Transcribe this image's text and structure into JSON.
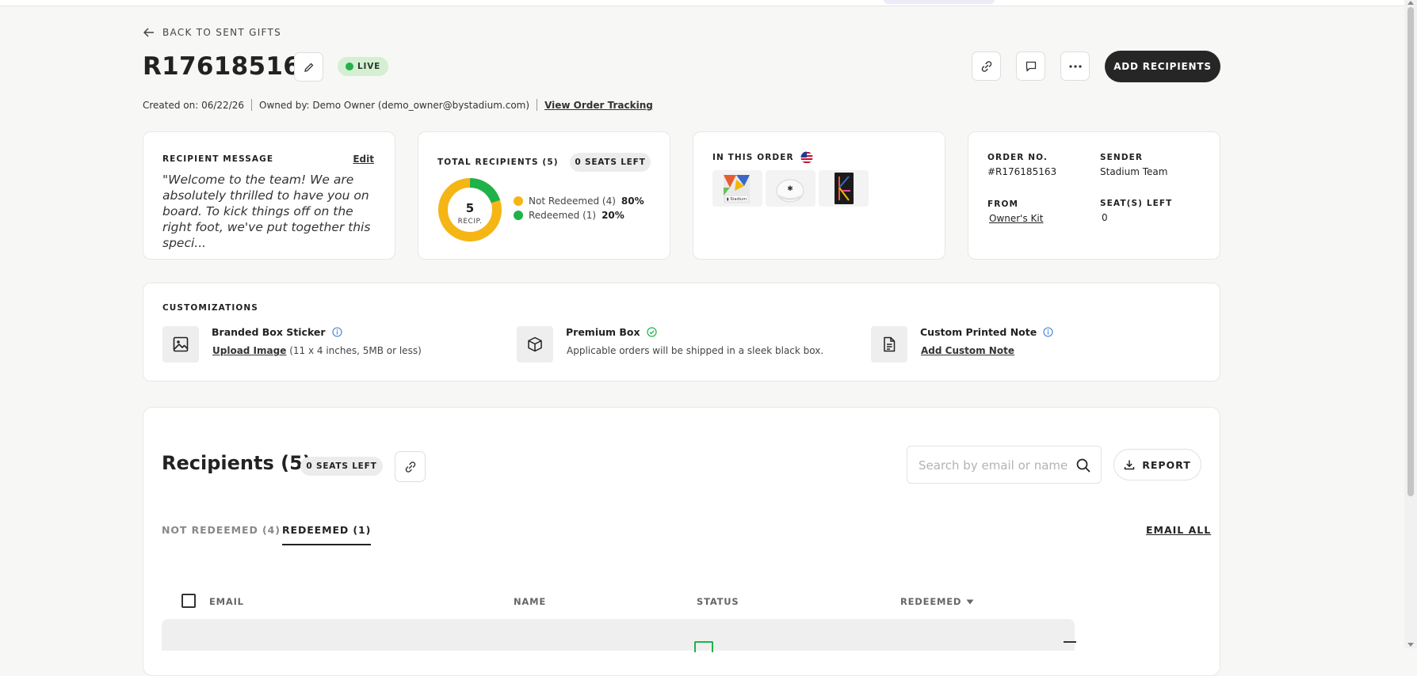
{
  "header": {
    "back_label": "BACK TO SENT GIFTS",
    "order_title": "R176185163",
    "status_label": "LIVE",
    "status_color": "#22b24c",
    "add_recipients_label": "ADD RECIPIENTS",
    "meta": {
      "created": "Created on: 06/22/26",
      "owner": "Owned by: Demo Owner (demo_owner@bystadium.com)",
      "tracking_link": "View Order Tracking"
    }
  },
  "message_card": {
    "label": "RECIPIENT MESSAGE",
    "edit_label": "Edit",
    "text": "\"Welcome to the team! We are absolutely thrilled to have you on board. To kick things off on the right foot, we've put together this speci..."
  },
  "recipients_card": {
    "label": "TOTAL RECIPIENTS (5)",
    "seats_badge": "0 SEATS LEFT",
    "donut_value": "5",
    "donut_unit": "RECIP.",
    "not_redeemed": {
      "label": "Not Redeemed (4)",
      "pct": "80%",
      "fraction": 0.8,
      "color": "#f5b514"
    },
    "redeemed": {
      "label": "Redeemed (1)",
      "pct": "20%",
      "fraction": 0.2,
      "color": "#1fb24a"
    }
  },
  "order_items_card": {
    "label": "IN THIS ORDER",
    "flag_icon": "us-flag-icon",
    "items": [
      "tote-bag",
      "white-cap",
      "notebook"
    ]
  },
  "order_info_card": {
    "order_no_label": "ORDER NO.",
    "order_no": "#R176185163",
    "sender_label": "SENDER",
    "sender": "Stadium Team",
    "from_label": "FROM",
    "from_link": "Owner's Kit",
    "seats_left_label": "SEAT(S) LEFT",
    "seats_left": "0"
  },
  "customizations": {
    "label": "CUSTOMIZATIONS",
    "items": [
      {
        "title": "Branded Box Sticker",
        "link": "Upload Image",
        "note": "(11 x 4 inches, 5MB or less)"
      },
      {
        "title": "Premium Box",
        "note": "Applicable orders will be shipped in a sleek black box."
      },
      {
        "title": "Custom Printed Note",
        "link": "Add Custom Note"
      }
    ]
  },
  "recipients_section": {
    "title": "Recipients (5)",
    "seats_badge": "0 SEATS LEFT",
    "search_placeholder": "Search by email or name",
    "report_label": "REPORT",
    "tabs": [
      {
        "label": "NOT REDEEMED (4)",
        "active": false
      },
      {
        "label": "REDEEMED (1)",
        "active": true
      }
    ],
    "email_all_label": "EMAIL ALL",
    "columns": [
      "EMAIL",
      "NAME",
      "STATUS",
      "REDEEMED"
    ]
  }
}
